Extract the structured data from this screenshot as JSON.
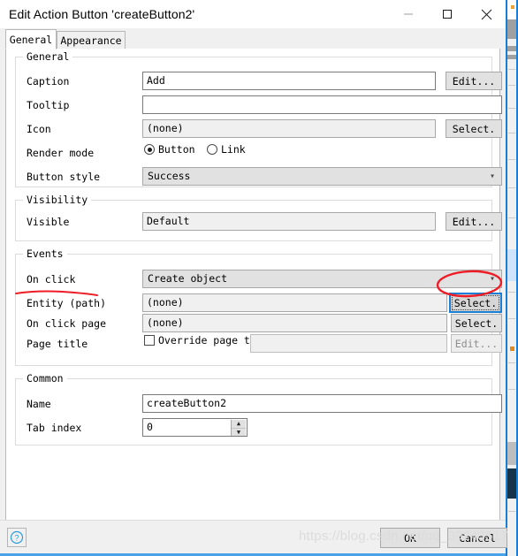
{
  "window": {
    "title": "Edit Action Button 'createButton2'",
    "minimize_label": "Minimize",
    "maximize_label": "Maximize",
    "close_label": "Close"
  },
  "tabs": [
    {
      "label": "General",
      "active": true
    },
    {
      "label": "Appearance",
      "active": false
    }
  ],
  "groups": {
    "general": {
      "title": "General",
      "caption": {
        "label": "Caption",
        "value": "Add",
        "button": "Edit..."
      },
      "tooltip": {
        "label": "Tooltip",
        "value": ""
      },
      "icon": {
        "label": "Icon",
        "value": "(none)",
        "button": "Select."
      },
      "render_mode": {
        "label": "Render mode",
        "options": [
          {
            "label": "Button",
            "checked": true
          },
          {
            "label": "Link",
            "checked": false
          }
        ]
      },
      "button_style": {
        "label": "Button style",
        "value": "Success"
      }
    },
    "visibility": {
      "title": "Visibility",
      "visible": {
        "label": "Visible",
        "value": "Default",
        "button": "Edit..."
      }
    },
    "events": {
      "title": "Events",
      "on_click": {
        "label": "On click",
        "value": "Create object"
      },
      "entity_path": {
        "label": "Entity (path)",
        "value": "(none)",
        "button": "Select."
      },
      "on_click_page": {
        "label": "On click page",
        "value": "(none)",
        "button": "Select."
      },
      "page_title": {
        "label": "Page title",
        "checkbox_label": "Override page t",
        "checked": false,
        "value": "",
        "button": "Edit..."
      }
    },
    "common": {
      "title": "Common",
      "name": {
        "label": "Name",
        "value": "createButton2"
      },
      "tab_index": {
        "label": "Tab index",
        "value": "0"
      }
    }
  },
  "footer": {
    "help_label": "?",
    "ok_label": "OK",
    "cancel_label": "Cancel"
  },
  "watermark": {
    "text": "https://blog.csdn.net/qq_39243517"
  },
  "annotations": {
    "underline_target": "Entity (path)",
    "circle_target": "Entity (path) Select. button",
    "color": "#ee1c25"
  },
  "colors": {
    "accent": "#1a7fd4",
    "annotation": "#ee1c25",
    "dialog_bg": "#f0f0f0",
    "page_bg": "#ffffff"
  }
}
